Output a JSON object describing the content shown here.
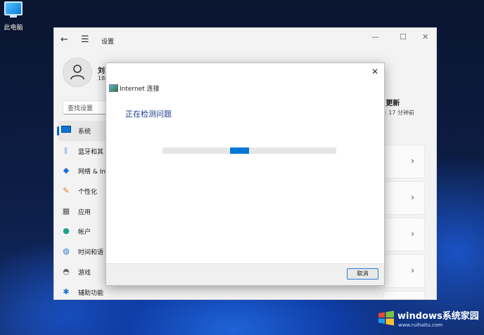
{
  "desktop": {
    "icon_label": "此电脑"
  },
  "settings": {
    "title": "设置",
    "profile": {
      "name": "刘",
      "email_partial": "184"
    },
    "search_placeholder": "查找设置",
    "nav": [
      {
        "label": "系统",
        "icon": "monitor-icon",
        "active": true
      },
      {
        "label": "蓝牙和其",
        "icon": "bluetooth-icon"
      },
      {
        "label": "网络 & In",
        "icon": "network-icon"
      },
      {
        "label": "个性化",
        "icon": "paintbrush-icon"
      },
      {
        "label": "应用",
        "icon": "apps-icon"
      },
      {
        "label": "帐户",
        "icon": "account-icon"
      },
      {
        "label": "时间和语",
        "icon": "globe-clock-icon"
      },
      {
        "label": "游戏",
        "icon": "gamepad-icon"
      },
      {
        "label": "辅助功能",
        "icon": "accessibility-icon"
      }
    ],
    "update_title": "s 更新",
    "update_sub": "间: 17 分钟前"
  },
  "dialog": {
    "title": "Internet 连接",
    "heading": "正在检测问题",
    "progress_indeterminate": true,
    "cancel_label": "取消"
  },
  "watermark": {
    "brand": "windows系统家园",
    "url": "www.ruihaitu.com"
  },
  "colors": {
    "accent": "#0078d7",
    "heading": "#1e3a8a"
  }
}
